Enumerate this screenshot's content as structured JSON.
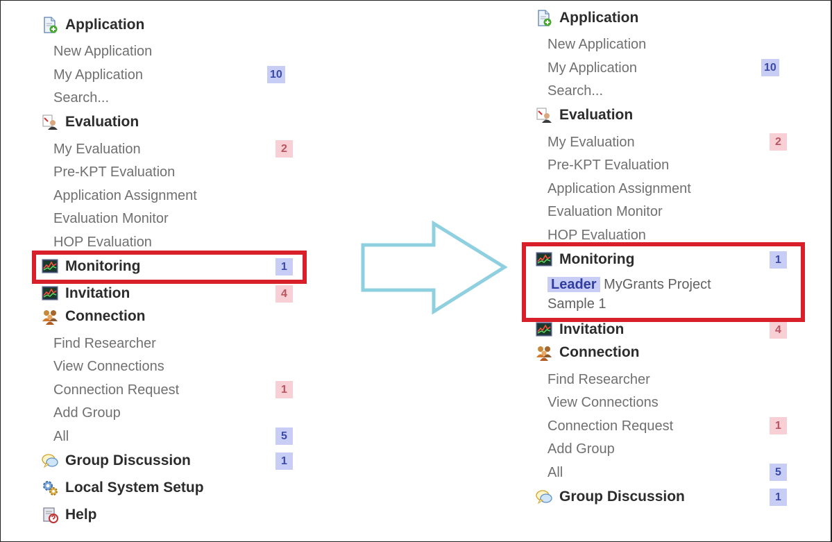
{
  "left": {
    "application": {
      "title": "Application",
      "items": [
        "New Application",
        "My Application",
        "Search..."
      ],
      "badge": "10"
    },
    "evaluation": {
      "title": "Evaluation",
      "items": [
        "My Evaluation",
        "Pre-KPT Evaluation",
        "Application Assignment",
        "Evaluation Monitor",
        "HOP Evaluation"
      ],
      "badge": "2"
    },
    "monitoring": {
      "title": "Monitoring",
      "badge": "1"
    },
    "invitation": {
      "title": "Invitation",
      "badge": "4"
    },
    "connection": {
      "title": "Connection",
      "items": [
        "Find Researcher",
        "View Connections",
        "Connection Request",
        "Add Group",
        "All"
      ],
      "request_badge": "1",
      "all_badge": "5"
    },
    "group_discussion": {
      "title": "Group Discussion",
      "badge": "1"
    },
    "local_system_setup": {
      "title": "Local System Setup"
    },
    "help": {
      "title": "Help"
    }
  },
  "right": {
    "application": {
      "title": "Application",
      "items": [
        "New Application",
        "My Application",
        "Search..."
      ],
      "badge": "10"
    },
    "evaluation": {
      "title": "Evaluation",
      "items": [
        "My Evaluation",
        "Pre-KPT Evaluation",
        "Application Assignment",
        "Evaluation Monitor",
        "HOP Evaluation"
      ],
      "badge": "2"
    },
    "monitoring": {
      "title": "Monitoring",
      "badge": "1",
      "project_role": "Leader",
      "project_name_line1": "MyGrants Project",
      "project_name_line2": "Sample 1"
    },
    "invitation": {
      "title": "Invitation",
      "badge": "4"
    },
    "connection": {
      "title": "Connection",
      "items": [
        "Find Researcher",
        "View Connections",
        "Connection Request",
        "Add Group",
        "All"
      ],
      "request_badge": "1",
      "all_badge": "5"
    },
    "group_discussion": {
      "title": "Group Discussion",
      "badge": "1"
    }
  },
  "icons": {
    "application": "document-add-icon",
    "evaluation": "evaluator-icon",
    "monitoring": "monitor-chart-icon",
    "invitation": "monitor-chart-icon",
    "connection": "people-group-icon",
    "group_discussion": "speech-bubble-icon",
    "local_system_setup": "gears-icon",
    "help": "help-book-icon"
  },
  "colors": {
    "highlight": "#d8202a",
    "arrow_outline": "#8fd0e0",
    "badge_blue": "#c8cdf5",
    "badge_pink": "#f7cfd4"
  }
}
